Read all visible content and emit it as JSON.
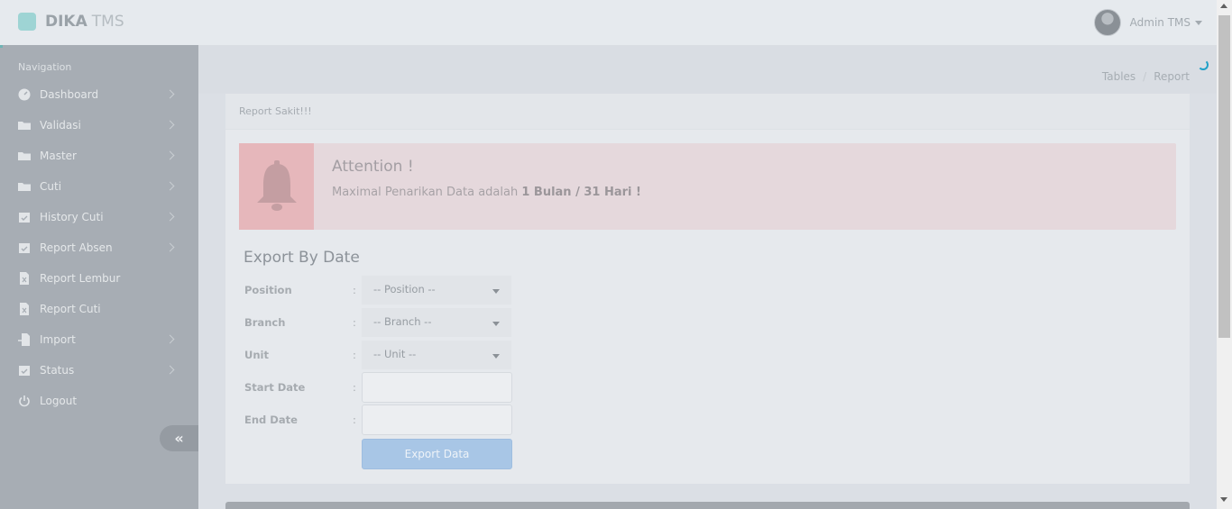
{
  "app": {
    "brand_name": "DIKA",
    "brand_sub": "TMS"
  },
  "user": {
    "name": "Admin TMS"
  },
  "sidebar": {
    "title": "Navigation",
    "items": [
      {
        "label": "Dashboard",
        "icon": "dashboard-icon",
        "has_submenu": true
      },
      {
        "label": "Validasi",
        "icon": "folder-icon",
        "has_submenu": true
      },
      {
        "label": "Master",
        "icon": "folder-icon",
        "has_submenu": true
      },
      {
        "label": "Cuti",
        "icon": "folder-icon",
        "has_submenu": true
      },
      {
        "label": "History Cuti",
        "icon": "calendar-check-icon",
        "has_submenu": true
      },
      {
        "label": "Report Absen",
        "icon": "calendar-check-icon",
        "has_submenu": true
      },
      {
        "label": "Report Lembur",
        "icon": "file-excel-icon",
        "has_submenu": false
      },
      {
        "label": "Report Cuti",
        "icon": "file-excel-icon",
        "has_submenu": false
      },
      {
        "label": "Import",
        "icon": "file-import-icon",
        "has_submenu": true
      },
      {
        "label": "Status",
        "icon": "calendar-check-icon",
        "has_submenu": true
      },
      {
        "label": "Logout",
        "icon": "power-icon",
        "has_submenu": false
      }
    ],
    "collapse_glyph": "«"
  },
  "breadcrumb": [
    "Tables",
    "Report"
  ],
  "card": {
    "title": "Report Sakit!!!"
  },
  "alert": {
    "title": "Attention !",
    "text_prefix": "Maximal Penarikan Data adalah ",
    "text_bold": "1 Bulan / 31 Hari !"
  },
  "form": {
    "title": "Export By Date",
    "colon": ":",
    "position_label": "Position",
    "position_value": "-- Position --",
    "branch_label": "Branch",
    "branch_value": "-- Branch --",
    "unit_label": "Unit",
    "unit_value": "-- Unit --",
    "start_date_label": "Start Date",
    "start_date_value": "",
    "end_date_label": "End Date",
    "end_date_value": "",
    "export_button": "Export Data"
  },
  "colors": {
    "alert_bg": "#e5d8dc",
    "alert_icon_bg": "#e6b7bb",
    "export_button": "#a8c6e6",
    "spinner": "#1fa0c8"
  }
}
